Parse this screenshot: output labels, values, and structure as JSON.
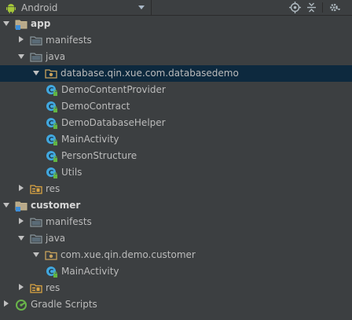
{
  "toolbar": {
    "view_label": "Android",
    "icons": [
      "target-icon",
      "collapse-icon",
      "settings-icon"
    ]
  },
  "tree": [
    {
      "label": "app",
      "type": "module",
      "expanded": true,
      "depth": 0,
      "bold": true
    },
    {
      "label": "manifests",
      "type": "folder",
      "expanded": false,
      "depth": 1
    },
    {
      "label": "java",
      "type": "folder",
      "expanded": true,
      "depth": 1
    },
    {
      "label": "database.qin.xue.com.databasedemo",
      "type": "package",
      "expanded": true,
      "depth": 2,
      "selected": true
    },
    {
      "label": "DemoContentProvider",
      "type": "class",
      "depth": 3
    },
    {
      "label": "DemoContract",
      "type": "class",
      "depth": 3
    },
    {
      "label": "DemoDatabaseHelper",
      "type": "class",
      "depth": 3
    },
    {
      "label": "MainActivity",
      "type": "class",
      "depth": 3
    },
    {
      "label": "PersonStructure",
      "type": "class",
      "depth": 3
    },
    {
      "label": "Utils",
      "type": "class",
      "depth": 3
    },
    {
      "label": "res",
      "type": "res",
      "expanded": false,
      "depth": 1
    },
    {
      "label": "customer",
      "type": "module",
      "expanded": true,
      "depth": 0,
      "bold": true
    },
    {
      "label": "manifests",
      "type": "folder",
      "expanded": false,
      "depth": 1
    },
    {
      "label": "java",
      "type": "folder",
      "expanded": true,
      "depth": 1
    },
    {
      "label": "com.xue.qin.demo.customer",
      "type": "package",
      "expanded": true,
      "depth": 2
    },
    {
      "label": "MainActivity",
      "type": "class",
      "depth": 3
    },
    {
      "label": "res",
      "type": "res",
      "expanded": false,
      "depth": 1
    },
    {
      "label": "Gradle Scripts",
      "type": "gradle",
      "expanded": false,
      "depth": 0
    }
  ],
  "colors": {
    "background": "#3c3f41",
    "selection": "#0d293e",
    "folder": "#87939a",
    "class_badge": "#41a8e0",
    "lock": "#62b543",
    "res_folder": "#d9a343",
    "module_badge": "#3d8ed9",
    "gradle": "#69b54a"
  }
}
